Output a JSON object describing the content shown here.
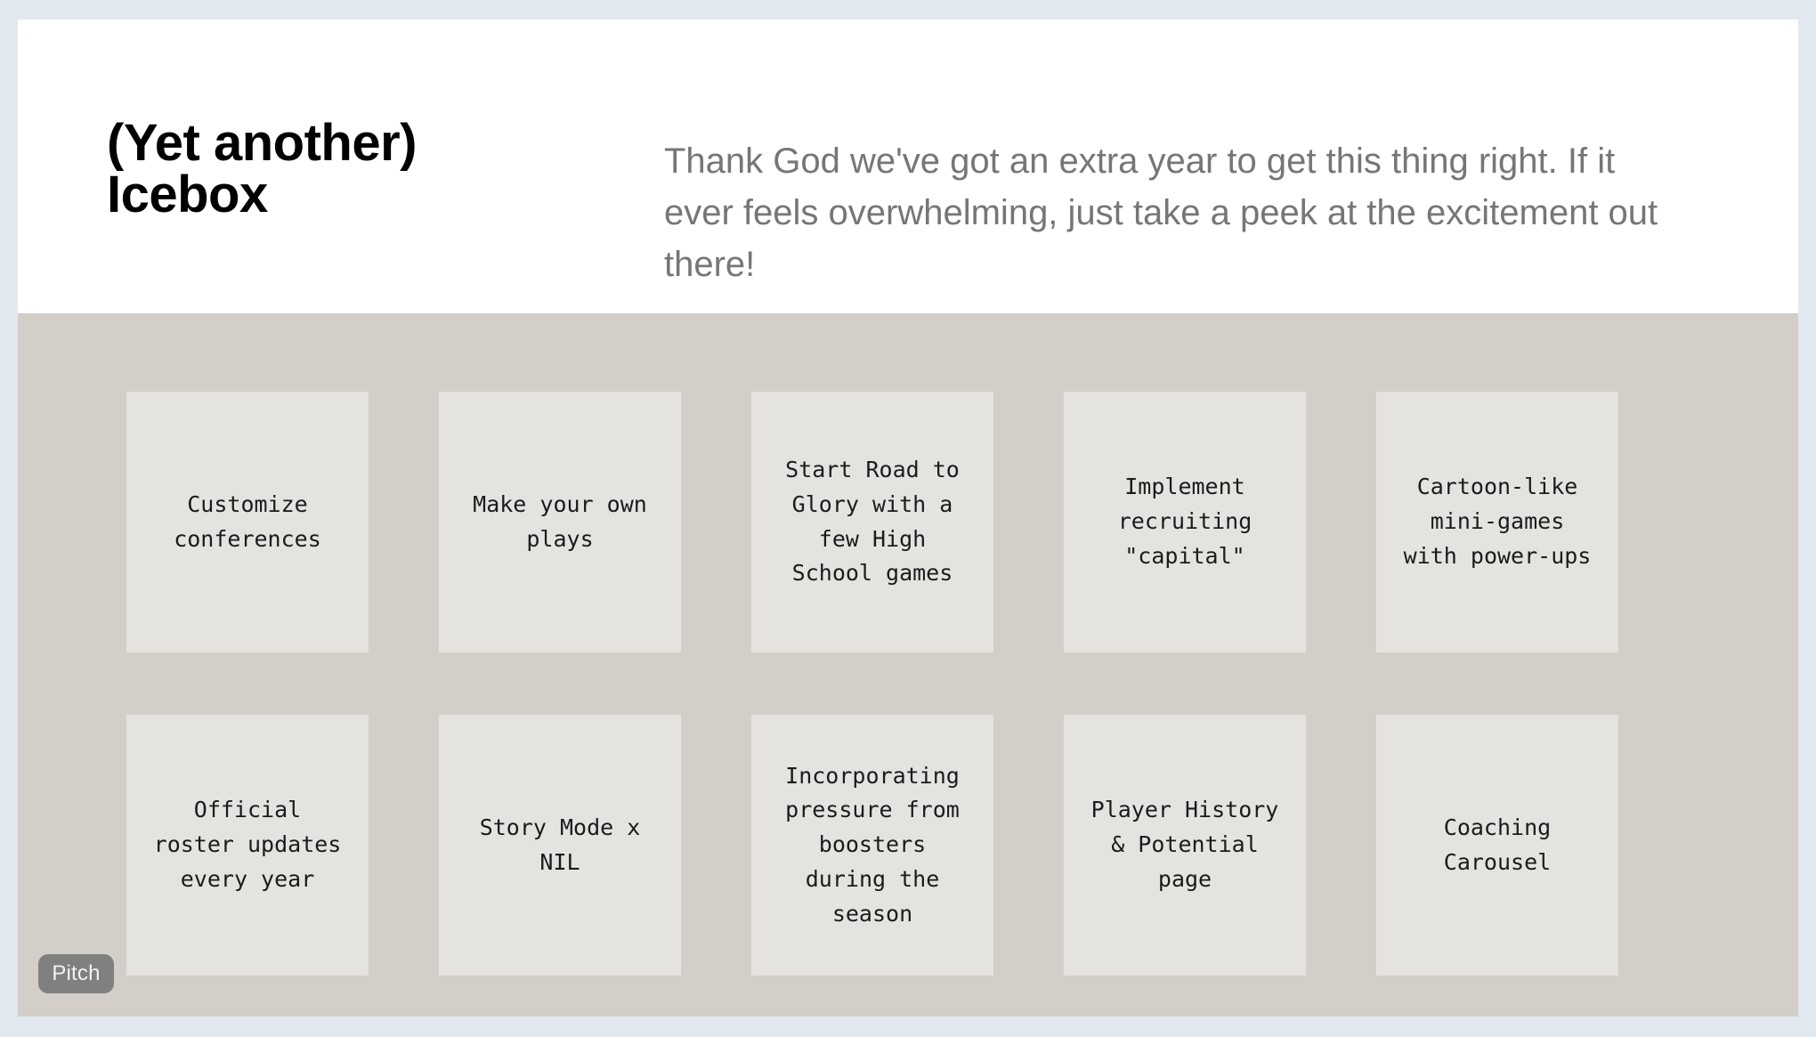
{
  "header": {
    "title": "(Yet another)\nIcebox",
    "subtitle": "Thank God we've got an extra year to get this thing right. If it ever feels overwhelming, just take a peek at the excitement out there!"
  },
  "cards": [
    {
      "text": "Customize\nconferences"
    },
    {
      "text": "Make your own\nplays"
    },
    {
      "text": "Start Road to\nGlory with a\nfew High\nSchool games"
    },
    {
      "text": "Implement\nrecruiting\n\"capital\""
    },
    {
      "text": "Cartoon-like\nmini-games\nwith power-ups"
    },
    {
      "text": "Official\nroster updates\nevery year"
    },
    {
      "text": "Story Mode x\nNIL"
    },
    {
      "text": "Incorporating\npressure from\nboosters\nduring the\nseason"
    },
    {
      "text": "Player History\n& Potential\npage"
    },
    {
      "text": "Coaching\nCarousel"
    }
  ],
  "watermark": {
    "label": "Pitch"
  },
  "colors": {
    "page_background": "#e2e8f0",
    "slide_background": "#ffffff",
    "content_background": "#d3cfc8",
    "card_background": "#e4e3df",
    "title_text": "#000000",
    "subtitle_text": "#767676",
    "card_text": "#1b1b1b",
    "watermark_background": "#808080",
    "watermark_text": "#f2f2f2"
  }
}
